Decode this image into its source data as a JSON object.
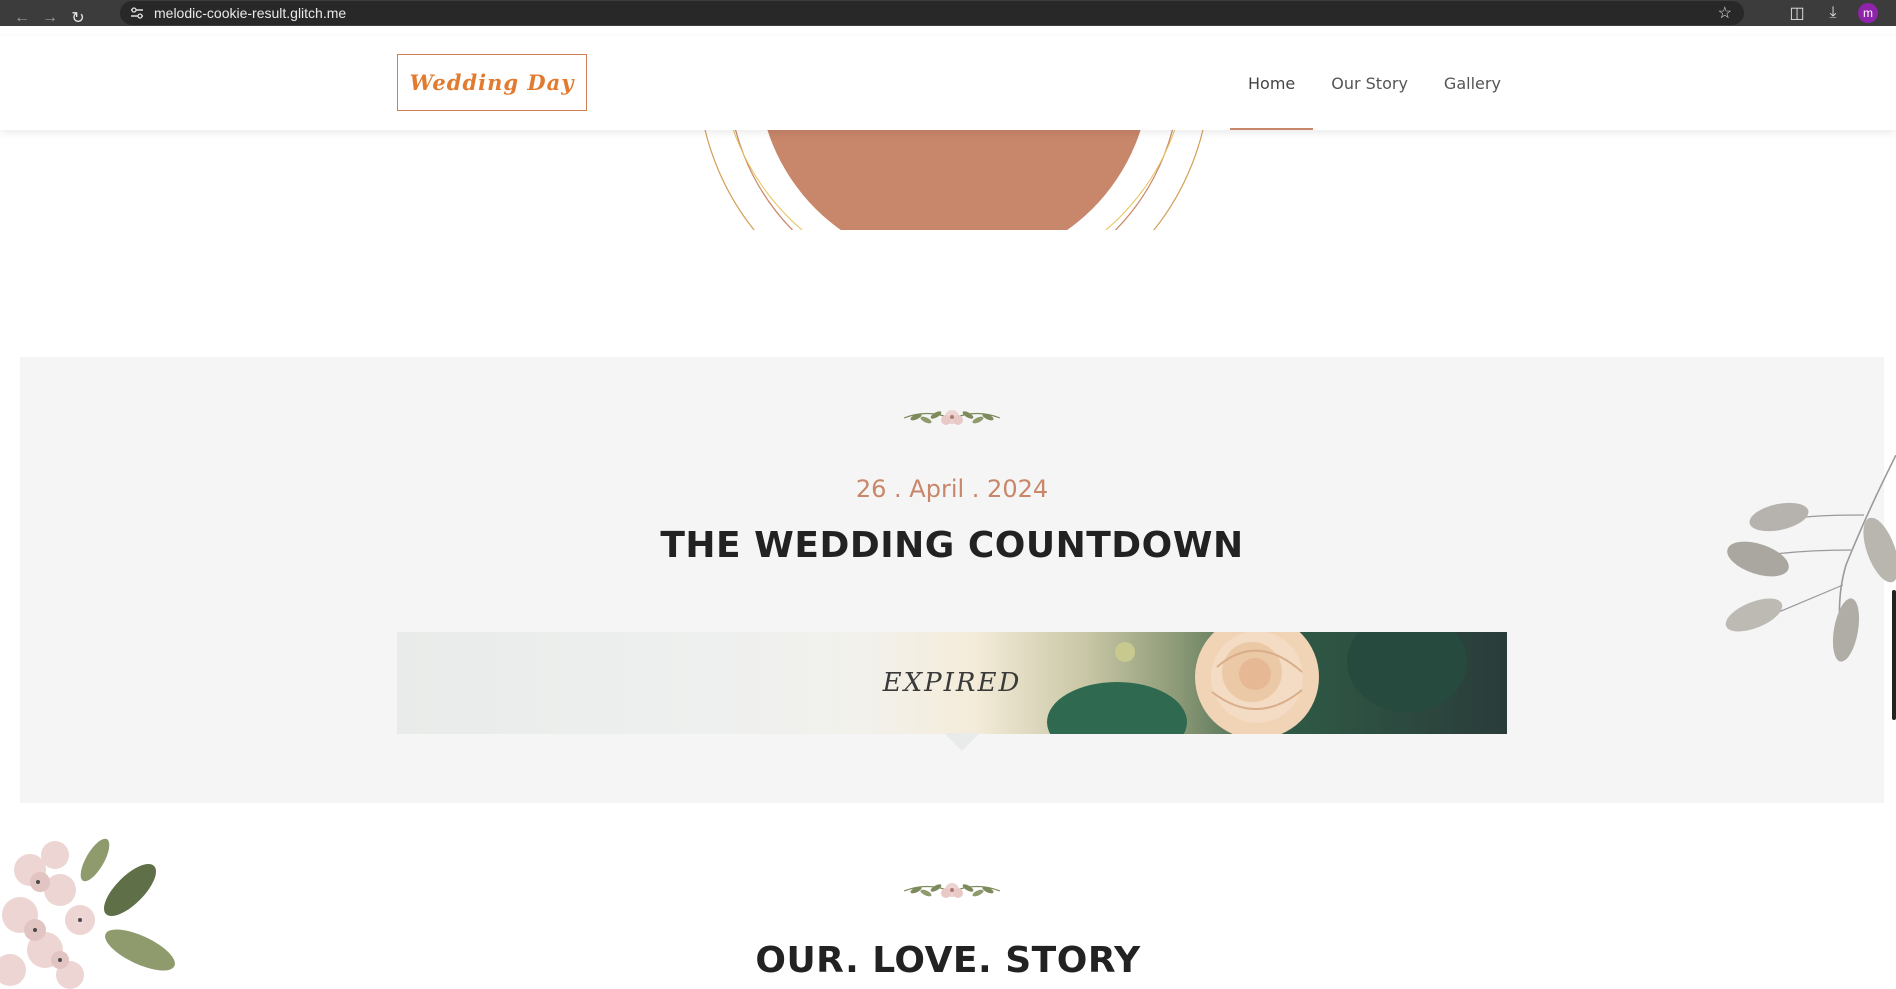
{
  "browser": {
    "url": "melodic-cookie-result.glitch.me",
    "profile_initial": "m",
    "icons": [
      "back-arrow-icon",
      "forward-arrow-icon",
      "reload-icon",
      "site-settings-icon",
      "bookmark-star-icon",
      "extensions-icon",
      "download-icon"
    ]
  },
  "header": {
    "logo_text": "Wedding Day",
    "nav": [
      {
        "label": "Home",
        "active": true
      },
      {
        "label": "Our Story",
        "active": false
      },
      {
        "label": "Gallery",
        "active": false
      }
    ]
  },
  "countdown": {
    "date": "26 . April . 2024",
    "title": "THE WEDDING COUNTDOWN",
    "status": "EXPIRED"
  },
  "story": {
    "title": "OUR. LOVE. STORY"
  },
  "colors": {
    "accent": "#c8866a",
    "logo": "#e27b2f",
    "section_bg": "#f5f5f5",
    "hero_circle": "#c8866a"
  }
}
